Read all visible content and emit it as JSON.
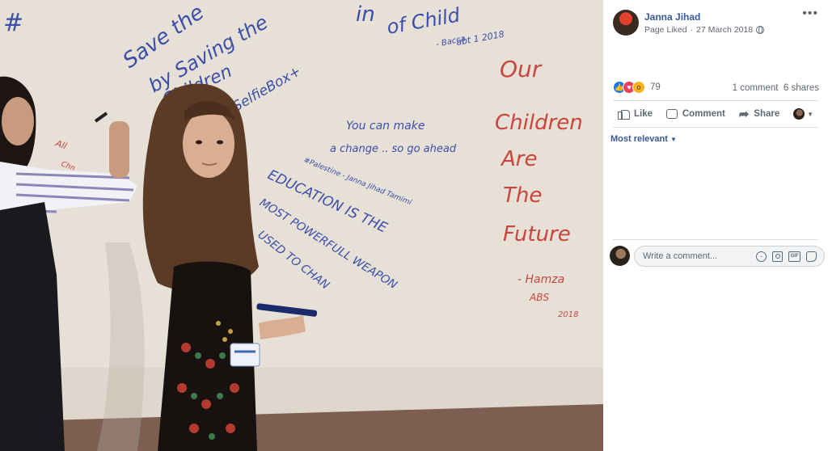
{
  "post": {
    "author": "Janna Jihad",
    "status": "Page Liked",
    "separator": "·",
    "date": "27 March 2018",
    "privacy_icon": "globe-icon",
    "more_icon": "more-options-icon"
  },
  "photo": {
    "wall_texts": {
      "hashtag": "#",
      "save_line1": "Save the",
      "save_line2": "by Saving the",
      "save_line3": "Children",
      "selfie": "SelfieBox+",
      "top_line1": "in",
      "top_line2": "of Child",
      "top_sig": "- Bacca",
      "top_date": "abt 1 2018",
      "change_line1": "You can make",
      "change_line2": "a change .. so go ahead",
      "palestine": "#Palestine - Janna Jihad Tamimi",
      "edu_line1": "EDUCATION IS THE",
      "edu_line2": "MOST POWERFULL WEAPON",
      "edu_line3": "USED TO CHAN",
      "red_1": "Our",
      "red_2": "Children",
      "red_3": "Are",
      "red_4": "The",
      "red_5": "Future",
      "red_sig": "- Hamza",
      "red_sig2": "ABS",
      "red_date": "2018",
      "left_red": "All",
      "left_red2": "Chn"
    }
  },
  "reactions": {
    "types": [
      "like",
      "love",
      "wow"
    ],
    "count": "79"
  },
  "engagement": {
    "comments": "1 comment",
    "shares": "6 shares"
  },
  "actions": {
    "like": "Like",
    "comment": "Comment",
    "share": "Share"
  },
  "comments": {
    "sort_label": "Most relevant",
    "placeholder": "Write a comment..."
  },
  "colors": {
    "link": "#385898",
    "muted": "#606770",
    "divider": "#dadde1",
    "like_blue": "#1877f2",
    "love_red": "#f33e58",
    "wow_yellow": "#f7b125",
    "marker_blue": "#3c4fa8",
    "marker_red": "#c8463e"
  }
}
